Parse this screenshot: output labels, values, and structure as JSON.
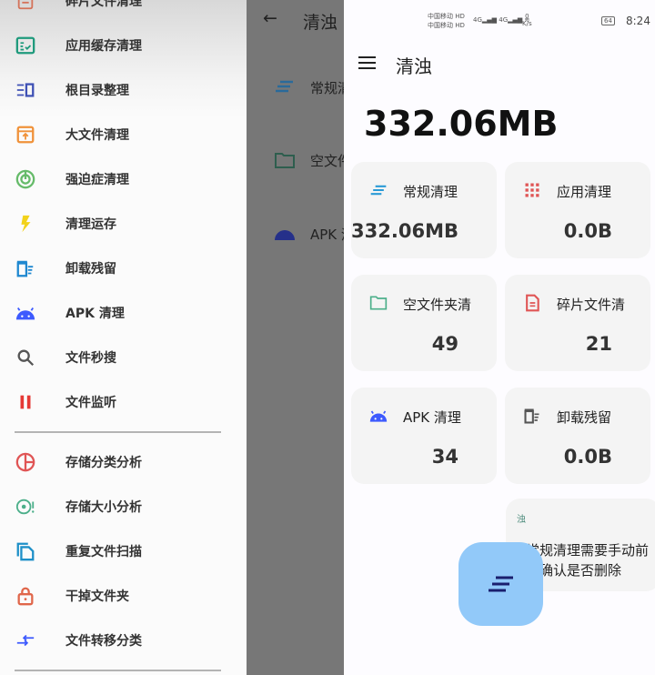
{
  "drawer": {
    "items": [
      {
        "label": "碎片文件清理",
        "icon": "fragment-file-icon",
        "color": "#d4735a"
      },
      {
        "label": "应用缓存清理",
        "icon": "app-cache-icon",
        "color": "#1f9a7c"
      },
      {
        "label": "根目录整理",
        "icon": "root-directory-icon",
        "color": "#3f51b5"
      },
      {
        "label": "大文件清理",
        "icon": "large-file-icon",
        "color": "#f0923a"
      },
      {
        "label": "强迫症清理",
        "icon": "radar-icon",
        "color": "#66bb6a"
      },
      {
        "label": "清理运存",
        "icon": "lightning-icon",
        "color": "#f2d21b"
      },
      {
        "label": "卸载残留",
        "icon": "uninstall-residue-icon",
        "color": "#1f88d0"
      },
      {
        "label": "APK 清理",
        "icon": "android-icon",
        "color": "#3d5afe"
      },
      {
        "label": "文件秒搜",
        "icon": "search-icon",
        "color": "#555555"
      },
      {
        "label": "文件监听",
        "icon": "pause-icon",
        "color": "#e53935"
      }
    ],
    "items2": [
      {
        "label": "存储分类分析",
        "icon": "pie-chart-icon",
        "color": "#e05555"
      },
      {
        "label": "存储大小分析",
        "icon": "storage-size-icon",
        "color": "#4caf8a"
      },
      {
        "label": "重复文件扫描",
        "icon": "duplicate-file-icon",
        "color": "#1e90c8"
      },
      {
        "label": "干掉文件夹",
        "icon": "lock-icon",
        "color": "#e0664a"
      },
      {
        "label": "文件转移分类",
        "icon": "transfer-icon",
        "color": "#3d5afe"
      }
    ]
  },
  "mid": {
    "title": "清浊",
    "rows": [
      "常规清理",
      "空文件夹清",
      "APK 清理"
    ]
  },
  "status": {
    "carrier1": "中国移动 HD",
    "carrier2": "中国移动 HD",
    "net1": "4G",
    "net2": "4G",
    "speed": "0",
    "speed_unit": "K/s",
    "battery": "64",
    "time": "8:24"
  },
  "header": {
    "title": "清浊"
  },
  "total": "332.06MB",
  "cards": [
    {
      "title": "常规清理",
      "value": "332.06MB",
      "icon": "list-lines-icon"
    },
    {
      "title": "应用清理",
      "value": "0.0B",
      "icon": "app-grid-icon"
    },
    {
      "title": "空文件夹清",
      "value": "49",
      "icon": "folder-icon"
    },
    {
      "title": "碎片文件清",
      "value": "21",
      "icon": "document-icon"
    },
    {
      "title": "APK 清理",
      "value": "34",
      "icon": "android-icon"
    },
    {
      "title": "卸载残留",
      "value": "0.0B",
      "icon": "uninstall-residue-icon"
    }
  ],
  "tip": {
    "badge": "浊",
    "line1": "常规清理需要手动前",
    "line2": "往确认是否删除"
  },
  "colors": {
    "fab": "#92c9f9",
    "accent": "#1e90c8"
  }
}
